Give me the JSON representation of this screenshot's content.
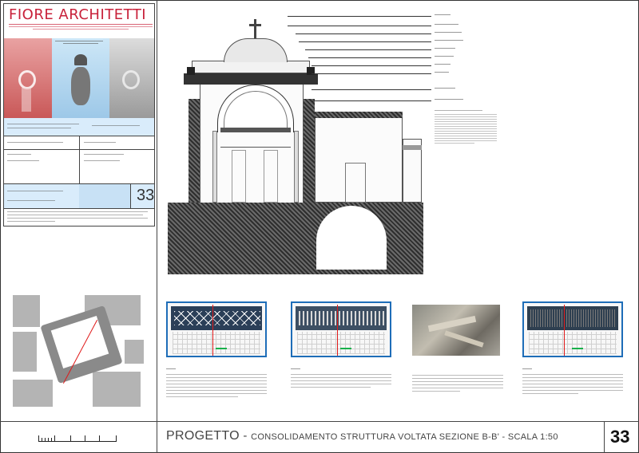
{
  "brand": "FIORE ARCHITETTI",
  "footer": {
    "title_main": "PROGETTO",
    "title_dash": " - ",
    "title_rest": "CONSOLIDAMENTO STRUTTURA VOLTATA SEZIONE B-B' - SCALA 1:50",
    "sheet_number": "33"
  },
  "title_block": {
    "sheet_number": "33"
  },
  "colors": {
    "brand_red": "#c8213a",
    "accent_blue": "#1e6db8",
    "section_red": "#e01a1a",
    "section_green": "#18b04a"
  }
}
